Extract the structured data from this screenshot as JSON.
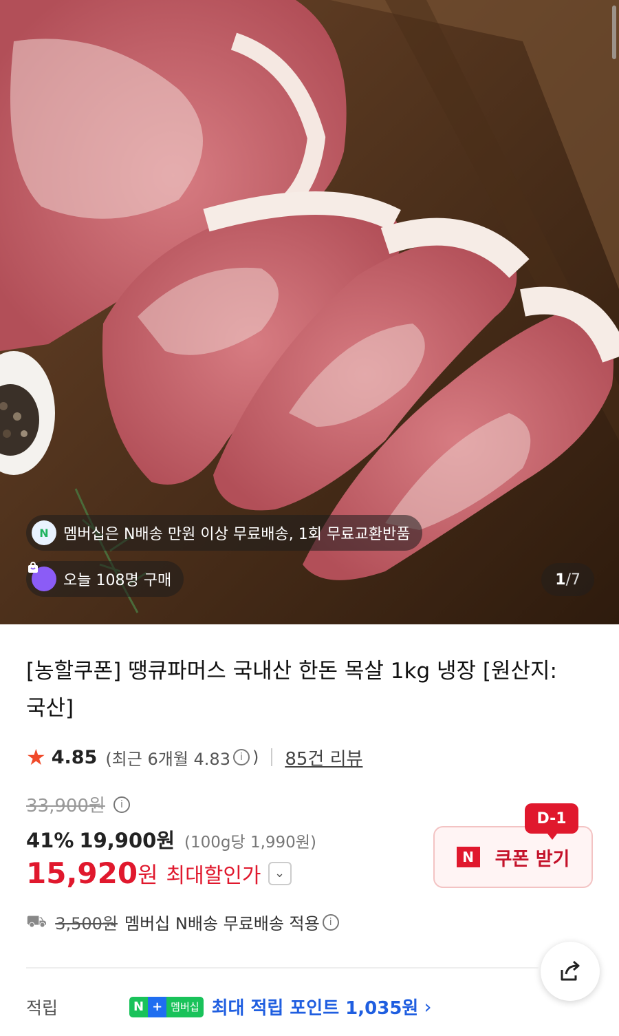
{
  "hero": {
    "membership_chip": "멤버십은 N배송 만원 이상 무료배송, 1회 무료교환반품",
    "membership_icon": "N",
    "today_chip": "오늘 108명 구매",
    "pager_current": "1",
    "pager_total": "/7"
  },
  "product": {
    "title": "[농할쿠폰] 땡큐파머스 국내산 한돈 목살 1kg 냉장 [원산지:국산]",
    "rating": "4.85",
    "recent_rating": "(최근 6개월 4.83",
    "recent_close": ")",
    "review_count": "85건 리뷰",
    "original_price": "33,900원",
    "discount_rate": "41%",
    "sale_price": "19,900원",
    "unit_price": "(100g당 1,990원)",
    "max_discount_value": "15,920",
    "max_discount_currency": "원",
    "max_discount_label": "최대할인가"
  },
  "coupon": {
    "d_tag": "D-1",
    "n_logo": "N",
    "label": "쿠폰 받기"
  },
  "shipping": {
    "original_fee": "3,500원",
    "text": "멤버십 N배송 무료배송 적용"
  },
  "points": {
    "label": "적립",
    "badge_n": "N",
    "badge_plus": "+",
    "badge_member": "멤버십",
    "text": "최대 적립 포인트 1,035원",
    "arrow": "›"
  },
  "icons": {
    "star": "★",
    "info": "i",
    "chevron": "⌄",
    "truck": "⛟"
  },
  "colors": {
    "accent_red": "#e0182d",
    "point_blue": "#1f5ee0",
    "naver_green": "#19c25a"
  }
}
